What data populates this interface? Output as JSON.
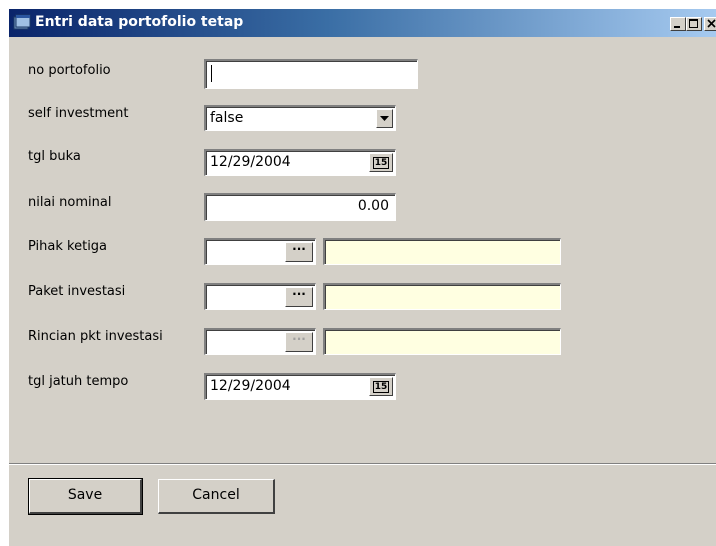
{
  "window": {
    "title": "Entri data portofolio tetap",
    "app_icon": "app-window-icon",
    "controls": {
      "minimize": "minimize-icon",
      "maximize": "maximize-icon",
      "close": "close-icon"
    }
  },
  "form": {
    "no_portofolio": {
      "label": "no portofolio",
      "value": ""
    },
    "self_investment": {
      "label": "self investment",
      "value": "false"
    },
    "tgl_buka": {
      "label": "tgl buka",
      "value": "12/29/2004",
      "button": "15"
    },
    "nilai_nominal": {
      "label": "nilai nominal",
      "value": "0.00"
    },
    "pihak_ketiga": {
      "label": "Pihak ketiga",
      "code": "",
      "name": "",
      "button": "···"
    },
    "paket_investasi": {
      "label": "Paket investasi",
      "code": "",
      "name": "",
      "button": "···"
    },
    "rincian_pkt_investasi": {
      "label": "Rincian pkt investasi",
      "code": "",
      "name": "",
      "button": "···"
    },
    "tgl_jatuh_tempo": {
      "label": "tgl jatuh tempo",
      "value": "12/29/2004",
      "button": "15"
    }
  },
  "buttons": {
    "save": "Save",
    "cancel": "Cancel"
  },
  "colors": {
    "title_gradient_start": "#0a246a",
    "title_gradient_end": "#a6caf0",
    "window_bg": "#d4d0c8",
    "lookup_field_bg": "#ffffe1"
  }
}
